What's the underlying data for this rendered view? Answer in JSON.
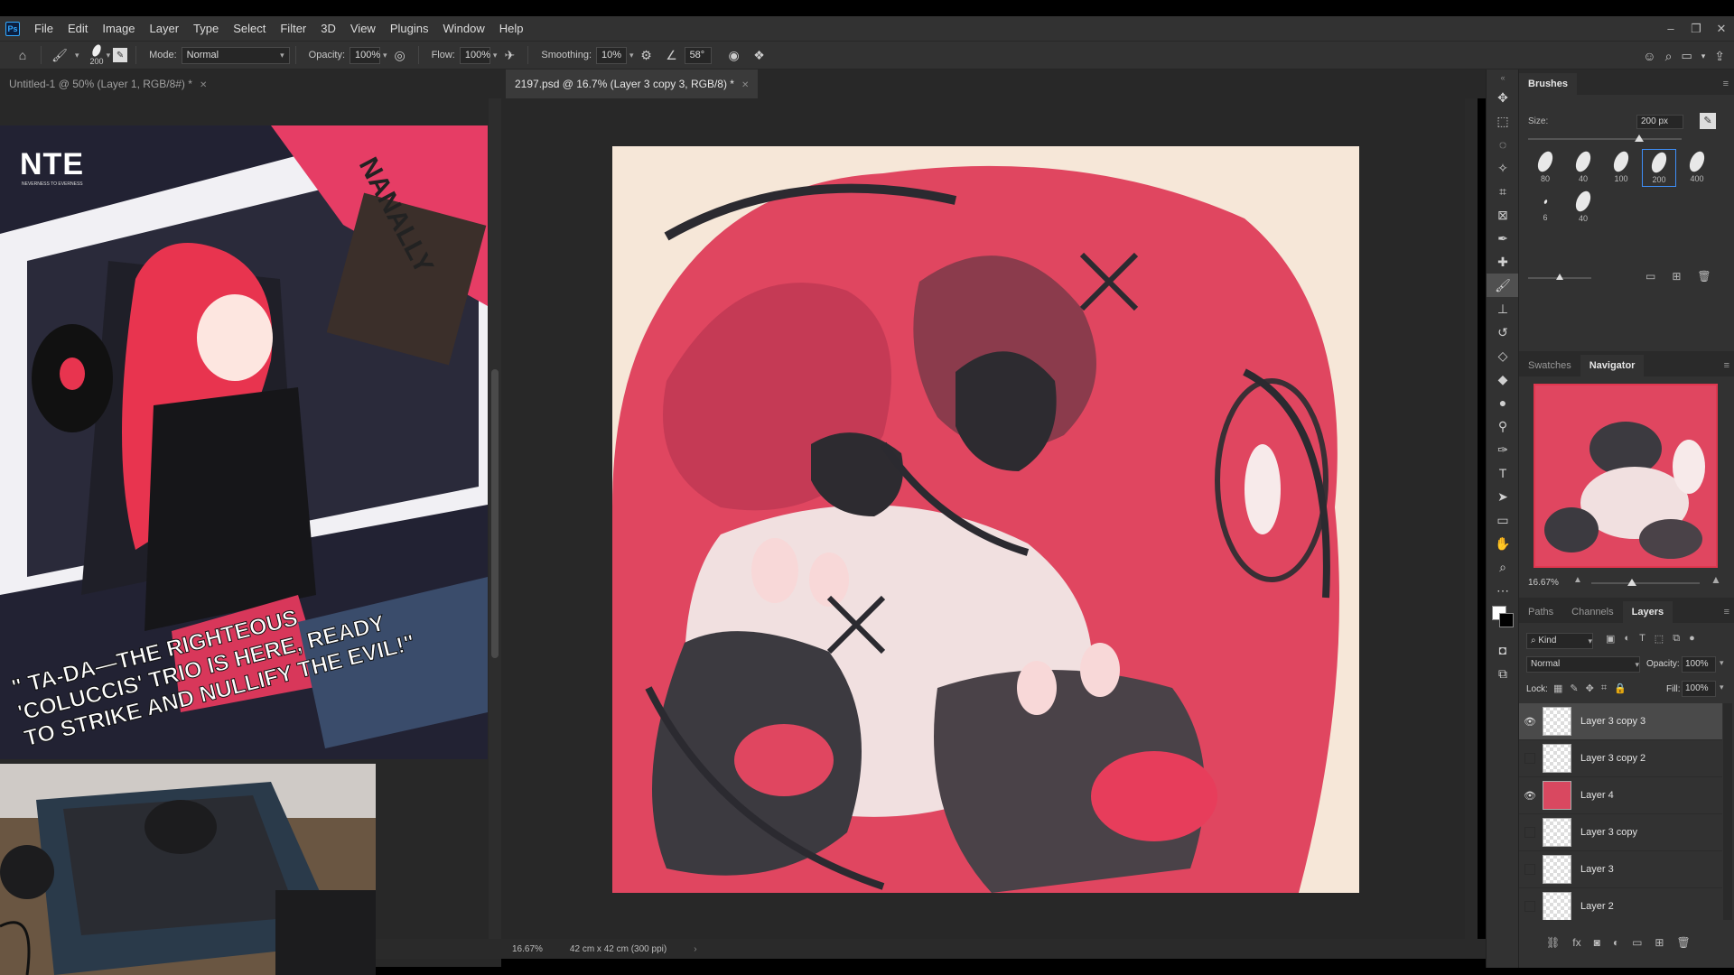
{
  "menubar": {
    "app_icon": "Ps",
    "items": [
      "File",
      "Edit",
      "Image",
      "Layer",
      "Type",
      "Select",
      "Filter",
      "3D",
      "View",
      "Plugins",
      "Window",
      "Help"
    ]
  },
  "options": {
    "brush_size": "200",
    "mode_label": "Mode:",
    "mode_value": "Normal",
    "opacity_label": "Opacity:",
    "opacity_value": "100%",
    "flow_label": "Flow:",
    "flow_value": "100%",
    "smoothing_label": "Smoothing:",
    "smoothing_value": "10%",
    "angle_value": "58°"
  },
  "tabs": [
    {
      "label": "Untitled-1 @ 50% (Layer 1, RGB/8#) *"
    },
    {
      "label": "2197.psd @ 16.7% (Layer 3 copy 3, RGB/8) *"
    }
  ],
  "reference": {
    "logo": "NTE",
    "logo_sub": "NEVERNESS TO EVERNESS",
    "banner": "NANALLY",
    "quote_line1": "\" TA-DA—THE RIGHTEOUS",
    "quote_line2": "'COLUCCIS' TRIO IS HERE, READY",
    "quote_line3": "TO STRIKE AND NULLIFY THE EVIL!\""
  },
  "status": {
    "zoom": "16.67%",
    "doc_size": "42 cm x 42 cm (300 ppi)"
  },
  "brushes_panel": {
    "title": "Brushes",
    "size_label": "Size:",
    "size_value": "200 px",
    "presets": [
      "80",
      "40",
      "100",
      "200",
      "400",
      "6",
      "40"
    ]
  },
  "nav_panel": {
    "tab_swatches": "Swatches",
    "tab_navigator": "Navigator",
    "zoom": "16.67%"
  },
  "layers_panel": {
    "tab_paths": "Paths",
    "tab_channels": "Channels",
    "tab_layers": "Layers",
    "kind_label": "Kind",
    "blend_mode": "Normal",
    "opacity_label": "Opacity:",
    "opacity_value": "100%",
    "lock_label": "Lock:",
    "fill_label": "Fill:",
    "fill_value": "100%",
    "layers": [
      {
        "name": "Layer 3 copy 3",
        "visible": true,
        "selected": true
      },
      {
        "name": "Layer 3 copy 2",
        "visible": false,
        "selected": false
      },
      {
        "name": "Layer 4",
        "visible": true,
        "selected": false
      },
      {
        "name": "Layer 3 copy",
        "visible": false,
        "selected": false
      },
      {
        "name": "Layer 3",
        "visible": false,
        "selected": false
      },
      {
        "name": "Layer 2",
        "visible": false,
        "selected": false
      }
    ]
  }
}
